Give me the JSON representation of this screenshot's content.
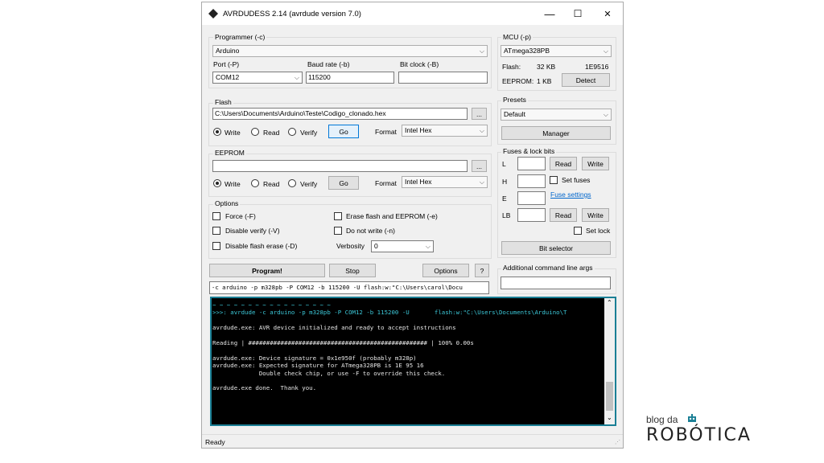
{
  "window": {
    "title": "AVRDUDESS 2.14 (avrdude version 7.0)",
    "minimize": "—",
    "maximize": "☐",
    "close": "✕"
  },
  "programmer": {
    "group_label": "Programmer (-c)",
    "value": "Arduino",
    "port_label": "Port (-P)",
    "port_value": "COM12",
    "baud_label": "Baud rate (-b)",
    "baud_value": "115200",
    "bitclock_label": "Bit clock (-B)",
    "bitclock_value": ""
  },
  "flash": {
    "group_label": "Flash",
    "path": "C:\\Users\\Documents\\Arduino\\Teste\\Codigo_clonado.hex",
    "browse": "...",
    "write": "Write",
    "read": "Read",
    "verify": "Verify",
    "go": "Go",
    "format_label": "Format",
    "format_value": "Intel Hex"
  },
  "eeprom": {
    "group_label": "EEPROM",
    "path": "",
    "browse": "...",
    "write": "Write",
    "read": "Read",
    "verify": "Verify",
    "go": "Go",
    "format_label": "Format",
    "format_value": "Intel Hex"
  },
  "options": {
    "group_label": "Options",
    "force": "Force (-F)",
    "disable_verify": "Disable verify (-V)",
    "disable_flash_erase": "Disable flash erase (-D)",
    "erase_flash": "Erase flash and EEPROM (-e)",
    "do_not_write": "Do not write (-n)",
    "verbosity_label": "Verbosity",
    "verbosity_value": "0"
  },
  "actions": {
    "program": "Program!",
    "stop": "Stop",
    "options": "Options",
    "help": "?",
    "command_line": "-c arduino -p m328pb -P COM12 -b 115200 -U flash:w:\"C:\\Users\\carol\\Docu"
  },
  "mcu": {
    "group_label": "MCU (-p)",
    "value": "ATmega328PB",
    "flash_label": "Flash:",
    "flash_size": "32 KB",
    "signature": "1E9516",
    "eeprom_label": "EEPROM:",
    "eeprom_size": "1 KB",
    "detect": "Detect"
  },
  "presets": {
    "group_label": "Presets",
    "value": "Default",
    "manager": "Manager"
  },
  "fuses": {
    "group_label": "Fuses & lock bits",
    "l": "L",
    "h": "H",
    "e": "E",
    "lb": "LB",
    "read": "Read",
    "write": "Write",
    "set_fuses": "Set fuses",
    "fuse_settings": "Fuse settings",
    "set_lock": "Set lock",
    "bit_selector": "Bit selector"
  },
  "additional": {
    "label": "Additional command line args",
    "value": ""
  },
  "console": {
    "lines": [
      "~ ~ ~ ~ ~ ~ ~ ~ ~ ~ ~ ~ ~ ~ ~ ~ ~",
      ">>>: avrdude -c arduino -p m328pb -P COM12 -b 115200 -U       flash:w:\"C:\\Users\\Documents\\Arduino\\T",
      "",
      "avrdude.exe: AVR device initialized and ready to accept instructions",
      "",
      "Reading | ################################################## | 100% 0.00s",
      "",
      "avrdude.exe: Device signature = 0x1e950f (probably m328p)",
      "avrdude.exe: Expected signature for ATmega328PB is 1E 95 16",
      "             Double check chip, or use -F to override this check.",
      "",
      "avrdude.exe done.  Thank you."
    ]
  },
  "status": {
    "text": "Ready"
  },
  "brand": {
    "top": "blog da",
    "name": "ROBÓTICA"
  }
}
